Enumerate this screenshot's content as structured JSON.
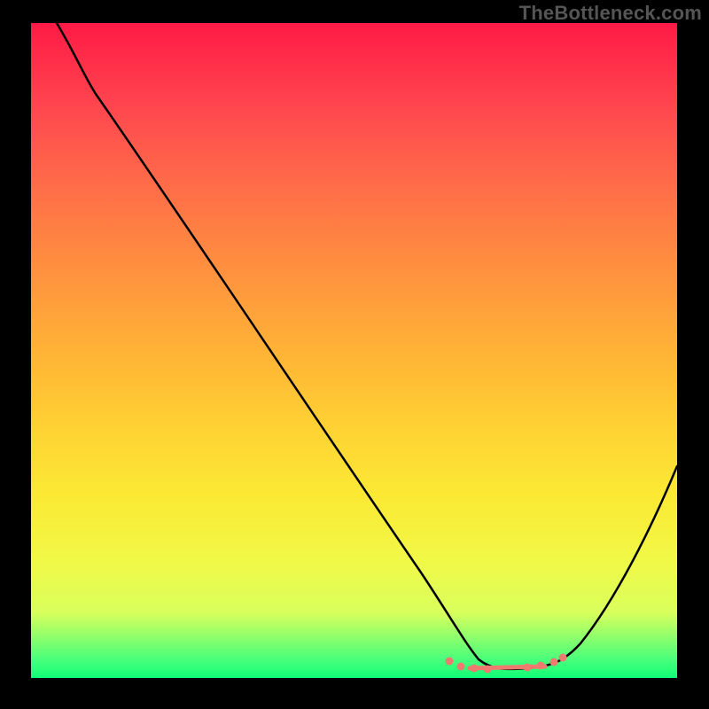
{
  "watermark": "TheBottleneck.com",
  "chart_data": {
    "type": "line",
    "title": "",
    "xlabel": "",
    "ylabel": "",
    "xlim": [
      0,
      100
    ],
    "ylim": [
      0,
      100
    ],
    "grid": false,
    "series": [
      {
        "name": "curve",
        "x": [
          4,
          10,
          20,
          30,
          40,
          50,
          60,
          64,
          68,
          72,
          76,
          80,
          84,
          88,
          92,
          96,
          100
        ],
        "values": [
          100,
          93,
          80,
          66.5,
          53,
          39.5,
          26,
          17,
          8,
          3,
          1.2,
          1.2,
          3,
          9,
          18,
          29,
          40
        ]
      }
    ],
    "annotations": {
      "dots_segment": {
        "x_start": 64,
        "x_end": 82,
        "y": 1.5,
        "visible_dots_x": [
          64,
          66,
          68,
          70,
          78,
          80,
          82
        ]
      }
    },
    "colors": {
      "curve": "#000000",
      "dots": "#ef7a6f",
      "gradient_top": "#ff1a45",
      "gradient_bottom": "#10ff78"
    }
  }
}
